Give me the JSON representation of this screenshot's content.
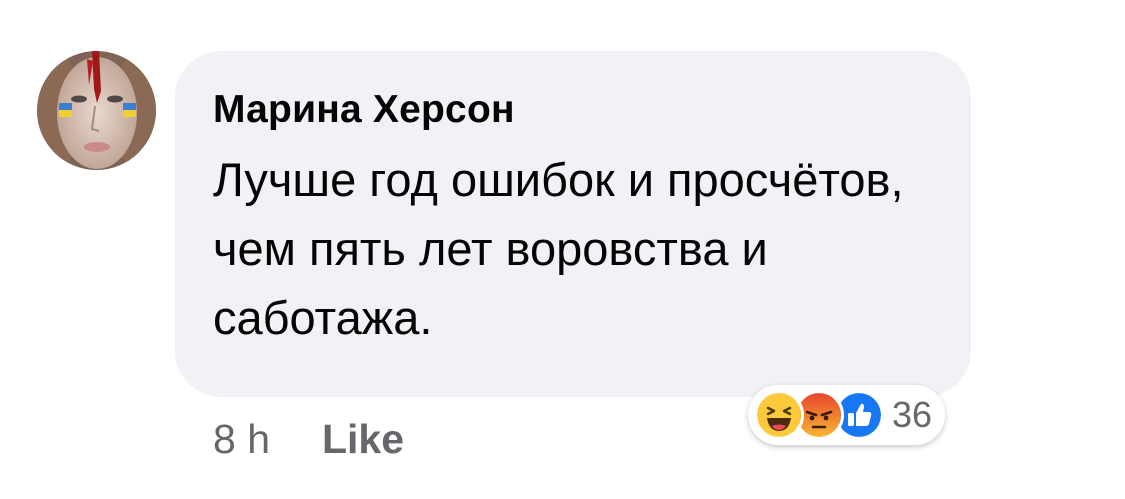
{
  "comment": {
    "author": "Марина Херсон",
    "text": "Лучше год ошибок и просчётов, чем пять лет воровства и саботажа.",
    "time": "8 h",
    "like_label": "Like",
    "reactions": {
      "icons": [
        "haha-icon",
        "angry-icon",
        "like-icon"
      ],
      "count": "36"
    }
  },
  "colors": {
    "bubble_bg": "#f0f2f5",
    "author": "#050505",
    "meta": "#65676b",
    "like_blue": "#1877f2",
    "haha_yellow": "#fcc93a",
    "angry_orange": "#f0662b"
  }
}
